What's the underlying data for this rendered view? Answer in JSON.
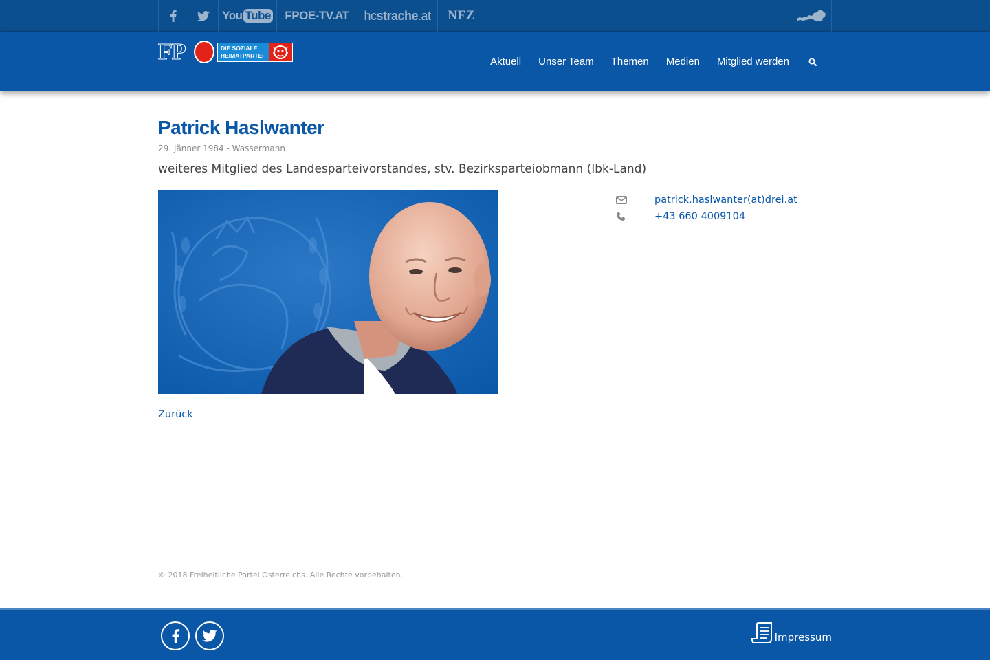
{
  "topbar": {
    "youtube": {
      "you": "You",
      "tube": "Tube"
    },
    "fpoetv": "FPOE-TV.AT",
    "hcstrache": {
      "hc": "hc",
      "strache": "strache",
      "at": ".at"
    },
    "nfz": "NFZ"
  },
  "header": {
    "logo": {
      "letters": "FP",
      "line1": "DIE SOZIALE",
      "line2": "HEIMATPARTEI"
    },
    "nav": [
      "Aktuell",
      "Unser Team",
      "Themen",
      "Medien",
      "Mitglied werden"
    ]
  },
  "person": {
    "name": "Patrick Haslwanter",
    "birth": "29. Jänner 1984 - Wassermann",
    "role": "weiteres Mitglied des Landesparteivorstandes, stv. Bezirksparteiobmann (Ibk-Land)",
    "email": "patrick.haslwanter(at)drei.at",
    "phone": "+43 660 4009104"
  },
  "back_label": "Zurück",
  "copyright": "© 2018 Freiheitliche Partei Österreichs. Alle Rechte vorbehalten.",
  "footer": {
    "impressum": "Impressum"
  },
  "colors": {
    "brand_blue": "#0a57a8",
    "topbar_blue": "#0c4f8f",
    "accent_red": "#e2231a"
  }
}
